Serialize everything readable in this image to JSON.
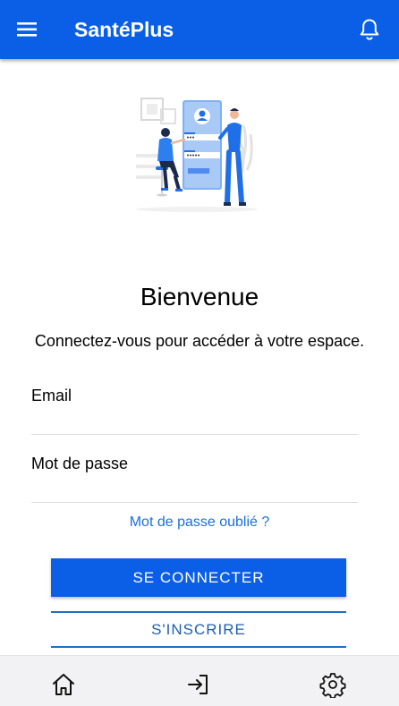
{
  "app": {
    "title": "SantéPlus"
  },
  "icons": {
    "menu": "menu-icon",
    "notifications": "bell-icon",
    "home": "home-icon",
    "login": "login-icon",
    "settings": "gear-icon"
  },
  "colors": {
    "primary": "#0a5fe6",
    "link": "#1a6fd8",
    "nav_background": "#f2f2f4"
  },
  "welcome": {
    "title": "Bienvenue",
    "subtitle": "Connectez-vous pour accéder à votre espace."
  },
  "form": {
    "email_placeholder": "Email",
    "password_placeholder": "Mot de passe",
    "forgot_password": "Mot de passe oublié ?",
    "login_button": "SE CONNECTER",
    "register_button": "S'INSCRIRE"
  }
}
